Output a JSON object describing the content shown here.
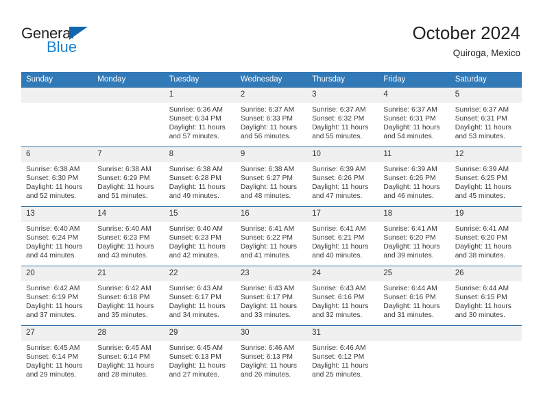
{
  "brand": {
    "name_part1": "General",
    "name_part2": "Blue",
    "triangle_icon": "triangle-icon",
    "accent_color": "#1b82d2",
    "dark_color": "#231f20"
  },
  "header": {
    "title": "October 2024",
    "subtitle": "Quiroga, Mexico"
  },
  "calendar": {
    "header_bg": "#3279b7",
    "header_text_color": "#ffffff",
    "row_divider_color": "#2e6da4",
    "daynum_bg": "#f0f0f0",
    "weekdays": [
      "Sunday",
      "Monday",
      "Tuesday",
      "Wednesday",
      "Thursday",
      "Friday",
      "Saturday"
    ],
    "weeks": [
      [
        {
          "day": "",
          "sunrise": "",
          "sunset": "",
          "daylight": ""
        },
        {
          "day": "",
          "sunrise": "",
          "sunset": "",
          "daylight": ""
        },
        {
          "day": "1",
          "sunrise": "Sunrise: 6:36 AM",
          "sunset": "Sunset: 6:34 PM",
          "daylight": "Daylight: 11 hours and 57 minutes."
        },
        {
          "day": "2",
          "sunrise": "Sunrise: 6:37 AM",
          "sunset": "Sunset: 6:33 PM",
          "daylight": "Daylight: 11 hours and 56 minutes."
        },
        {
          "day": "3",
          "sunrise": "Sunrise: 6:37 AM",
          "sunset": "Sunset: 6:32 PM",
          "daylight": "Daylight: 11 hours and 55 minutes."
        },
        {
          "day": "4",
          "sunrise": "Sunrise: 6:37 AM",
          "sunset": "Sunset: 6:31 PM",
          "daylight": "Daylight: 11 hours and 54 minutes."
        },
        {
          "day": "5",
          "sunrise": "Sunrise: 6:37 AM",
          "sunset": "Sunset: 6:31 PM",
          "daylight": "Daylight: 11 hours and 53 minutes."
        }
      ],
      [
        {
          "day": "6",
          "sunrise": "Sunrise: 6:38 AM",
          "sunset": "Sunset: 6:30 PM",
          "daylight": "Daylight: 11 hours and 52 minutes."
        },
        {
          "day": "7",
          "sunrise": "Sunrise: 6:38 AM",
          "sunset": "Sunset: 6:29 PM",
          "daylight": "Daylight: 11 hours and 51 minutes."
        },
        {
          "day": "8",
          "sunrise": "Sunrise: 6:38 AM",
          "sunset": "Sunset: 6:28 PM",
          "daylight": "Daylight: 11 hours and 49 minutes."
        },
        {
          "day": "9",
          "sunrise": "Sunrise: 6:38 AM",
          "sunset": "Sunset: 6:27 PM",
          "daylight": "Daylight: 11 hours and 48 minutes."
        },
        {
          "day": "10",
          "sunrise": "Sunrise: 6:39 AM",
          "sunset": "Sunset: 6:26 PM",
          "daylight": "Daylight: 11 hours and 47 minutes."
        },
        {
          "day": "11",
          "sunrise": "Sunrise: 6:39 AM",
          "sunset": "Sunset: 6:26 PM",
          "daylight": "Daylight: 11 hours and 46 minutes."
        },
        {
          "day": "12",
          "sunrise": "Sunrise: 6:39 AM",
          "sunset": "Sunset: 6:25 PM",
          "daylight": "Daylight: 11 hours and 45 minutes."
        }
      ],
      [
        {
          "day": "13",
          "sunrise": "Sunrise: 6:40 AM",
          "sunset": "Sunset: 6:24 PM",
          "daylight": "Daylight: 11 hours and 44 minutes."
        },
        {
          "day": "14",
          "sunrise": "Sunrise: 6:40 AM",
          "sunset": "Sunset: 6:23 PM",
          "daylight": "Daylight: 11 hours and 43 minutes."
        },
        {
          "day": "15",
          "sunrise": "Sunrise: 6:40 AM",
          "sunset": "Sunset: 6:23 PM",
          "daylight": "Daylight: 11 hours and 42 minutes."
        },
        {
          "day": "16",
          "sunrise": "Sunrise: 6:41 AM",
          "sunset": "Sunset: 6:22 PM",
          "daylight": "Daylight: 11 hours and 41 minutes."
        },
        {
          "day": "17",
          "sunrise": "Sunrise: 6:41 AM",
          "sunset": "Sunset: 6:21 PM",
          "daylight": "Daylight: 11 hours and 40 minutes."
        },
        {
          "day": "18",
          "sunrise": "Sunrise: 6:41 AM",
          "sunset": "Sunset: 6:20 PM",
          "daylight": "Daylight: 11 hours and 39 minutes."
        },
        {
          "day": "19",
          "sunrise": "Sunrise: 6:41 AM",
          "sunset": "Sunset: 6:20 PM",
          "daylight": "Daylight: 11 hours and 38 minutes."
        }
      ],
      [
        {
          "day": "20",
          "sunrise": "Sunrise: 6:42 AM",
          "sunset": "Sunset: 6:19 PM",
          "daylight": "Daylight: 11 hours and 37 minutes."
        },
        {
          "day": "21",
          "sunrise": "Sunrise: 6:42 AM",
          "sunset": "Sunset: 6:18 PM",
          "daylight": "Daylight: 11 hours and 35 minutes."
        },
        {
          "day": "22",
          "sunrise": "Sunrise: 6:43 AM",
          "sunset": "Sunset: 6:17 PM",
          "daylight": "Daylight: 11 hours and 34 minutes."
        },
        {
          "day": "23",
          "sunrise": "Sunrise: 6:43 AM",
          "sunset": "Sunset: 6:17 PM",
          "daylight": "Daylight: 11 hours and 33 minutes."
        },
        {
          "day": "24",
          "sunrise": "Sunrise: 6:43 AM",
          "sunset": "Sunset: 6:16 PM",
          "daylight": "Daylight: 11 hours and 32 minutes."
        },
        {
          "day": "25",
          "sunrise": "Sunrise: 6:44 AM",
          "sunset": "Sunset: 6:16 PM",
          "daylight": "Daylight: 11 hours and 31 minutes."
        },
        {
          "day": "26",
          "sunrise": "Sunrise: 6:44 AM",
          "sunset": "Sunset: 6:15 PM",
          "daylight": "Daylight: 11 hours and 30 minutes."
        }
      ],
      [
        {
          "day": "27",
          "sunrise": "Sunrise: 6:45 AM",
          "sunset": "Sunset: 6:14 PM",
          "daylight": "Daylight: 11 hours and 29 minutes."
        },
        {
          "day": "28",
          "sunrise": "Sunrise: 6:45 AM",
          "sunset": "Sunset: 6:14 PM",
          "daylight": "Daylight: 11 hours and 28 minutes."
        },
        {
          "day": "29",
          "sunrise": "Sunrise: 6:45 AM",
          "sunset": "Sunset: 6:13 PM",
          "daylight": "Daylight: 11 hours and 27 minutes."
        },
        {
          "day": "30",
          "sunrise": "Sunrise: 6:46 AM",
          "sunset": "Sunset: 6:13 PM",
          "daylight": "Daylight: 11 hours and 26 minutes."
        },
        {
          "day": "31",
          "sunrise": "Sunrise: 6:46 AM",
          "sunset": "Sunset: 6:12 PM",
          "daylight": "Daylight: 11 hours and 25 minutes."
        },
        {
          "day": "",
          "sunrise": "",
          "sunset": "",
          "daylight": ""
        },
        {
          "day": "",
          "sunrise": "",
          "sunset": "",
          "daylight": ""
        }
      ]
    ]
  }
}
